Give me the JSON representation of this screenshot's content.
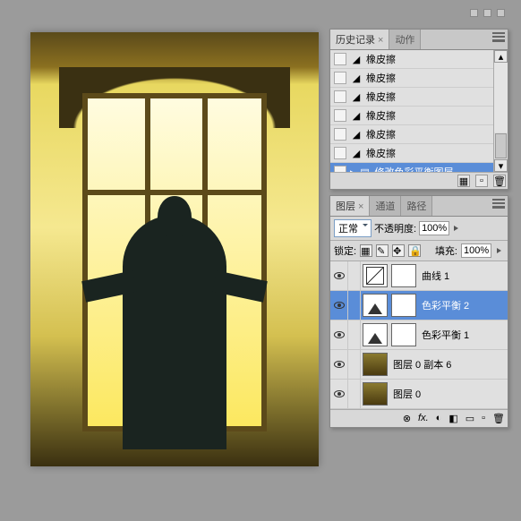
{
  "window_buttons": {
    "dash": "–",
    "min": "▫",
    "close": "×"
  },
  "history": {
    "tabs": [
      "历史记录",
      "动作"
    ],
    "items": [
      {
        "label": "橡皮擦"
      },
      {
        "label": "橡皮擦"
      },
      {
        "label": "橡皮擦"
      },
      {
        "label": "橡皮擦"
      },
      {
        "label": "橡皮擦"
      },
      {
        "label": "橡皮擦"
      },
      {
        "label": "修改色彩平衡图层",
        "selected": true
      }
    ],
    "footer_icons": [
      "▦",
      "⊕",
      "🗑"
    ]
  },
  "layers": {
    "tabs": [
      "图层",
      "通道",
      "路径"
    ],
    "blend_mode": "正常",
    "opacity_label": "不透明度:",
    "opacity_value": "100%",
    "lock_label": "锁定:",
    "fill_label": "填充:",
    "fill_value": "100%",
    "items": [
      {
        "label": "曲线 1",
        "type": "curve"
      },
      {
        "label": "色彩平衡 2",
        "type": "adjust",
        "selected": true
      },
      {
        "label": "色彩平衡 1",
        "type": "adjust"
      },
      {
        "label": "图层 0 副本 6",
        "type": "img"
      },
      {
        "label": "图层 0",
        "type": "img"
      }
    ],
    "footer_icons": [
      "⊗",
      "fx.",
      "◐",
      "◧",
      "▭",
      "⊕",
      "🗑"
    ]
  }
}
